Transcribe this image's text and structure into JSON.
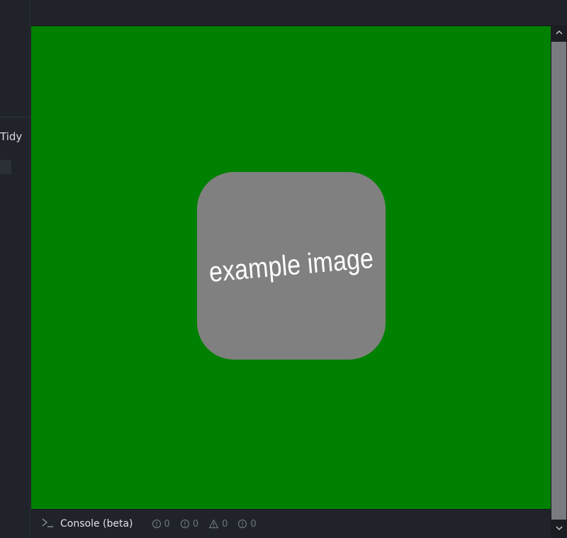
{
  "sidebar": {
    "tidy_label": "Tidy"
  },
  "preview": {
    "background_color": "#008000",
    "image": {
      "text": "example image",
      "background_color": "#808080"
    }
  },
  "scrollbar": {
    "up_icon": "chevron-up-icon",
    "down_icon": "chevron-down-icon"
  },
  "console": {
    "prompt_icon": "terminal-prompt-icon",
    "label": "Console (beta)",
    "counts": [
      {
        "icon": "error-icon",
        "value": "0"
      },
      {
        "icon": "info-icon",
        "value": "0"
      },
      {
        "icon": "warning-icon",
        "value": "0"
      },
      {
        "icon": "log-icon",
        "value": "0"
      }
    ]
  }
}
